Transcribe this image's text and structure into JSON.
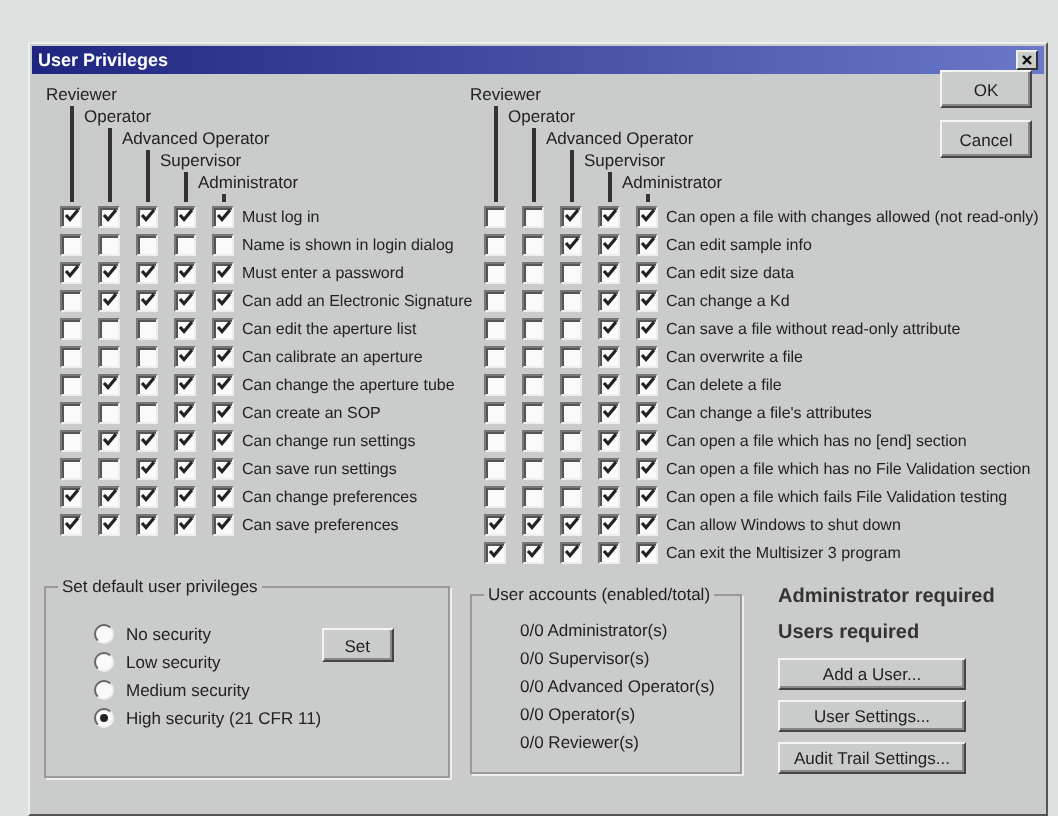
{
  "window": {
    "title": "User Privileges"
  },
  "left_pane": {
    "roles": [
      "Reviewer",
      "Operator",
      "Advanced Operator",
      "Supervisor",
      "Administrator"
    ],
    "rows": [
      {
        "label": "Must log in",
        "checks": [
          true,
          true,
          true,
          true,
          true
        ]
      },
      {
        "label": "Name is shown in login dialog",
        "checks": [
          false,
          false,
          false,
          false,
          false
        ]
      },
      {
        "label": "Must enter a password",
        "checks": [
          true,
          true,
          true,
          true,
          true
        ]
      },
      {
        "label": "Can add an Electronic Signature",
        "checks": [
          false,
          true,
          true,
          true,
          true
        ]
      },
      {
        "label": "Can edit the aperture list",
        "checks": [
          false,
          false,
          false,
          true,
          true
        ]
      },
      {
        "label": "Can calibrate an aperture",
        "checks": [
          false,
          false,
          false,
          true,
          true
        ]
      },
      {
        "label": "Can change the aperture tube",
        "checks": [
          false,
          true,
          true,
          true,
          true
        ]
      },
      {
        "label": "Can create an SOP",
        "checks": [
          false,
          false,
          false,
          true,
          true
        ]
      },
      {
        "label": "Can change run settings",
        "checks": [
          false,
          true,
          true,
          true,
          true
        ]
      },
      {
        "label": "Can save run settings",
        "checks": [
          false,
          false,
          true,
          true,
          true
        ]
      },
      {
        "label": "Can change preferences",
        "checks": [
          true,
          true,
          true,
          true,
          true
        ]
      },
      {
        "label": "Can save preferences",
        "checks": [
          true,
          true,
          true,
          true,
          true
        ]
      }
    ]
  },
  "right_pane": {
    "roles": [
      "Reviewer",
      "Operator",
      "Advanced Operator",
      "Supervisor",
      "Administrator"
    ],
    "rows": [
      {
        "label": "Can open a file with changes allowed (not read-only)",
        "checks": [
          false,
          false,
          true,
          true,
          true
        ]
      },
      {
        "label": "Can edit sample info",
        "checks": [
          false,
          false,
          true,
          true,
          true
        ]
      },
      {
        "label": "Can edit size data",
        "checks": [
          false,
          false,
          false,
          true,
          true
        ]
      },
      {
        "label": "Can change a Kd",
        "checks": [
          false,
          false,
          false,
          true,
          true
        ]
      },
      {
        "label": "Can save a file without read-only attribute",
        "checks": [
          false,
          false,
          false,
          true,
          true
        ]
      },
      {
        "label": "Can overwrite a file",
        "checks": [
          false,
          false,
          false,
          true,
          true
        ]
      },
      {
        "label": "Can delete a file",
        "checks": [
          false,
          false,
          false,
          true,
          true
        ]
      },
      {
        "label": "Can change a file's attributes",
        "checks": [
          false,
          false,
          false,
          true,
          true
        ]
      },
      {
        "label": "Can open a file which has no [end] section",
        "checks": [
          false,
          false,
          false,
          true,
          true
        ]
      },
      {
        "label": "Can open a file which has no File Validation section",
        "checks": [
          false,
          false,
          false,
          true,
          true
        ]
      },
      {
        "label": "Can open a file which fails File Validation testing",
        "checks": [
          false,
          false,
          false,
          true,
          true
        ]
      },
      {
        "label": "Can allow Windows to shut down",
        "checks": [
          true,
          true,
          true,
          true,
          true
        ]
      },
      {
        "label": "Can exit the Multisizer 3 program",
        "checks": [
          true,
          true,
          true,
          true,
          true
        ]
      }
    ]
  },
  "buttons": [
    "OK",
    "Cancel"
  ],
  "default_privileges": {
    "title": "Set default user privileges",
    "options": [
      {
        "label": "No security",
        "selected": false
      },
      {
        "label": "Low security",
        "selected": false
      },
      {
        "label": "Medium security",
        "selected": false
      },
      {
        "label": "High security (21 CFR 11)",
        "selected": true
      }
    ],
    "set_button": "Set"
  },
  "user_accounts": {
    "title": "User accounts (enabled/total)",
    "rows": [
      "0/0  Administrator(s)",
      "0/0  Supervisor(s)",
      "0/0  Advanced Operator(s)",
      "0/0  Operator(s)",
      "0/0  Reviewer(s)"
    ]
  },
  "messages": [
    "Administrator required",
    "Users required"
  ],
  "actions": [
    "Add a User...",
    "User Settings...",
    "Audit Trail Settings..."
  ]
}
